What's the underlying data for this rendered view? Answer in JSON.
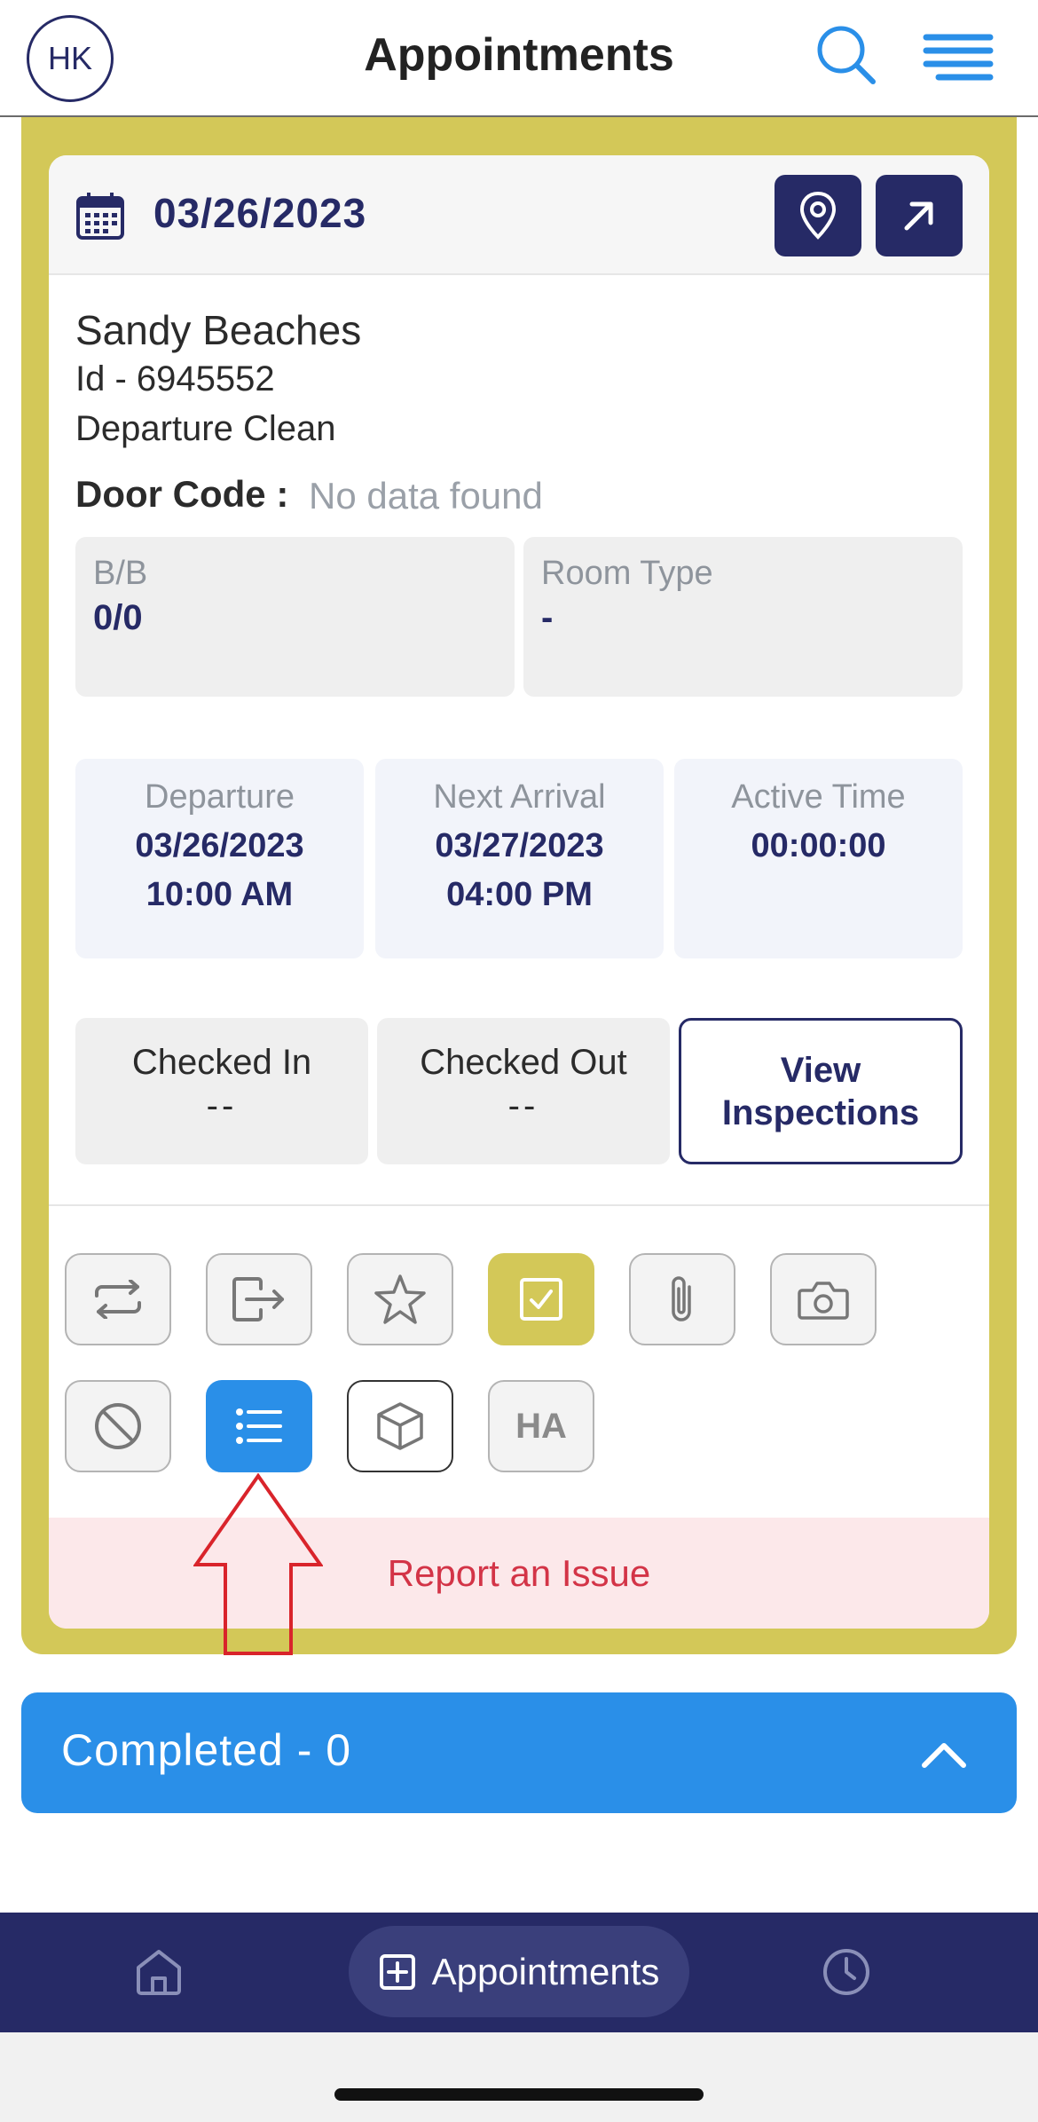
{
  "header": {
    "avatar_initials": "HK",
    "title": "Appointments",
    "icons": [
      "search-icon",
      "menu-icon"
    ]
  },
  "appointment": {
    "date": "03/26/2023",
    "guest_name": "Sandy Beaches",
    "id_line": "Id - 6945552",
    "service": "Departure Clean",
    "door_code_label": "Door Code :",
    "door_code_value": "No data found",
    "bb_label": "B/B",
    "bb_value": "0/0",
    "room_type_label": "Room Type",
    "room_type_value": "-",
    "departure_label": "Departure",
    "departure_date": "03/26/2023",
    "departure_time": "10:00 AM",
    "next_arrival_label": "Next Arrival",
    "next_arrival_date": "03/27/2023",
    "next_arrival_time": "04:00 PM",
    "active_time_label": "Active Time",
    "active_time_value": "00:00:00",
    "checked_in_label": "Checked In",
    "checked_in_value": "--",
    "checked_out_label": "Checked Out",
    "checked_out_value": "--",
    "view_inspections_label": "View Inspections",
    "action_ha_label": "HA",
    "report_issue_label": "Report an Issue"
  },
  "completed": {
    "label": "Completed - 0"
  },
  "bottom_nav": {
    "active_label": "Appointments"
  },
  "colors": {
    "navy": "#262a66",
    "olive": "#d3c858",
    "blue": "#2a8fe8",
    "report_text": "#d33447",
    "report_bg": "#fce8ea"
  }
}
